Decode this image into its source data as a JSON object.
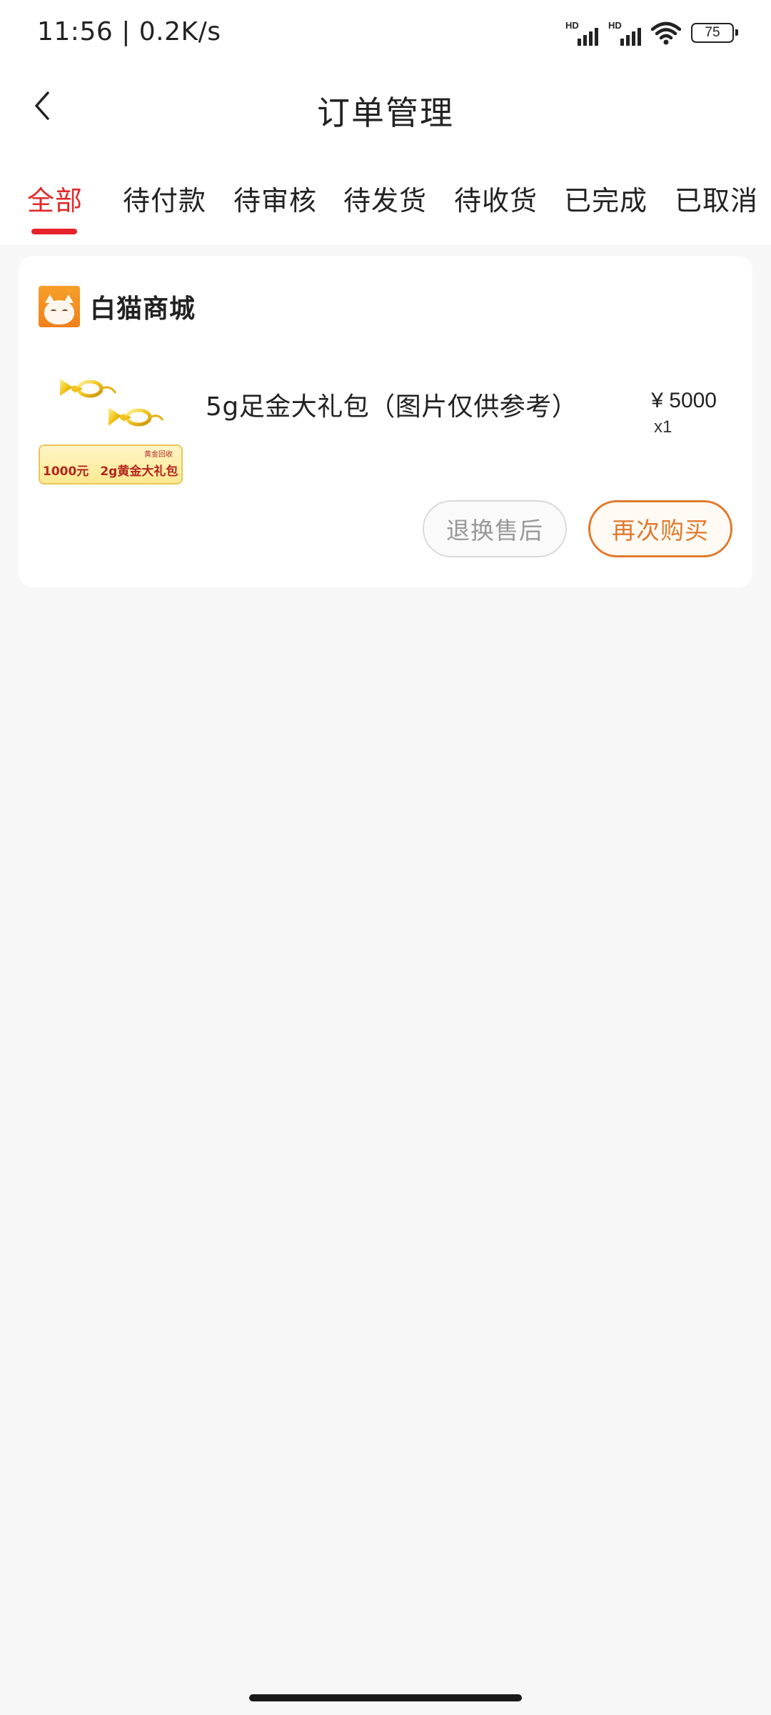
{
  "status_bar": {
    "time": "11:56 | 0.2K/s",
    "signal_1_label": "HD",
    "signal_2_label": "HD",
    "battery": "75"
  },
  "nav": {
    "title": "订单管理",
    "back_icon": "chevron-left-icon"
  },
  "tabs": [
    {
      "label": "全部",
      "active": true
    },
    {
      "label": "待付款",
      "active": false
    },
    {
      "label": "待审核",
      "active": false
    },
    {
      "label": "待发货",
      "active": false
    },
    {
      "label": "待收货",
      "active": false
    },
    {
      "label": "已完成",
      "active": false
    },
    {
      "label": "已取消",
      "active": false
    }
  ],
  "order": {
    "shop_name": "白猫商城",
    "product": {
      "title": "5g足金大礼包（图片仅供参考）",
      "price": "¥ 5000",
      "quantity": "x1",
      "thumb_banner_top": "黄金回收",
      "thumb_banner_price": "1000元",
      "thumb_banner_label": "2g黄金大礼包"
    },
    "buttons": {
      "return_label": "退换售后",
      "rebuy_label": "再次购买"
    }
  },
  "colors": {
    "accent_red": "#e6232a",
    "rebuy_orange": "#e07a2c",
    "page_bg": "#f7f7f7"
  }
}
